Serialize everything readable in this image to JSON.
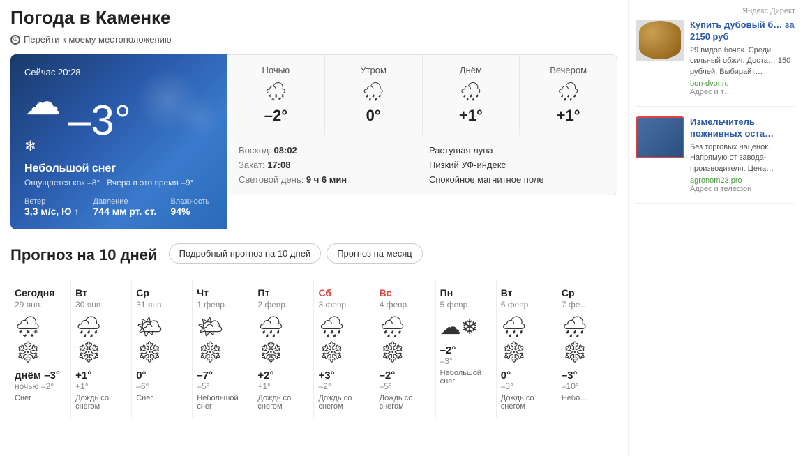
{
  "page": {
    "title": "Погода в Каменке",
    "location_link": "Перейти к моему местоположению"
  },
  "current": {
    "time": "Сейчас 20:28",
    "temp": "–3°",
    "icon": "🌨",
    "description": "Небольшой снег",
    "feels_like": "Ощущается как –8°",
    "yesterday": "Вчера в это время –9°",
    "wind_label": "Ветер",
    "wind_value": "3,3 м/с, Ю ↑",
    "pressure_label": "Давление",
    "pressure_value": "744 мм рт. ст.",
    "humidity_label": "Влажность",
    "humidity_value": "94%"
  },
  "periods": [
    {
      "name": "Ночью",
      "icon": "🌨",
      "temp": "–2°"
    },
    {
      "name": "Утром",
      "icon": "🌧",
      "temp": "0°"
    },
    {
      "name": "Днём",
      "icon": "🌧",
      "temp": "+1°"
    },
    {
      "name": "Вечером",
      "icon": "🌧",
      "temp": "+1°"
    }
  ],
  "sun_moon": [
    {
      "label": "Восход:",
      "value": "08:02"
    },
    {
      "label": "Растущая луна",
      "value": ""
    },
    {
      "label": "Закат:",
      "value": "17:08"
    },
    {
      "label": "Низкий УФ-индекс",
      "value": ""
    },
    {
      "label": "Световой день:",
      "value": "9 ч 6 мин"
    },
    {
      "label": "Спокойное магнитное поле",
      "value": ""
    }
  ],
  "forecast_section": {
    "title": "Прогноз на 10 дней",
    "btn1": "Подробный прогноз на 10 дней",
    "btn2": "Прогноз на месяц"
  },
  "ten_days": [
    {
      "name": "Сегодня",
      "date": "29 янв.",
      "icon": "🌨❄",
      "high": "днём –3°",
      "low": "ночью –2°",
      "desc": "Снег",
      "weekend": false
    },
    {
      "name": "Вт",
      "date": "30 янв.",
      "icon": "🌧❄",
      "high": "+1°",
      "low": "+1°",
      "desc": "Дождь со снегом",
      "weekend": false
    },
    {
      "name": "Ср",
      "date": "31 янв.",
      "icon": "🌤❄",
      "high": "0°",
      "low": "–6°",
      "desc": "Снег",
      "weekend": false
    },
    {
      "name": "Чт",
      "date": "1 февр.",
      "icon": "🌤❄",
      "high": "–7°",
      "low": "–5°",
      "desc": "Небольшой снег",
      "weekend": false
    },
    {
      "name": "Пт",
      "date": "2 февр.",
      "icon": "🌧❄",
      "high": "+2°",
      "low": "+1°",
      "desc": "Дождь со снегом",
      "weekend": false
    },
    {
      "name": "Сб",
      "date": "3 февр.",
      "icon": "🌧❄",
      "high": "+3°",
      "low": "–2°",
      "desc": "Дождь со снегом",
      "weekend": true
    },
    {
      "name": "Вс",
      "date": "4 февр.",
      "icon": "🌧❄",
      "high": "–2°",
      "low": "–5°",
      "desc": "Дождь со снегом",
      "weekend": true
    },
    {
      "name": "Пн",
      "date": "5 февр.",
      "icon": "☁❄",
      "high": "–2°",
      "low": "–3°",
      "desc": "Небольшой снег",
      "weekend": false
    },
    {
      "name": "Вт",
      "date": "6 февр.",
      "icon": "🌧❄",
      "high": "0°",
      "low": "–3°",
      "desc": "Дождь со снегом",
      "weekend": false
    },
    {
      "name": "Ср",
      "date": "7 фе…",
      "icon": "🌧❄",
      "high": "–3°",
      "low": "–10°",
      "desc": "Небо…",
      "weekend": false
    }
  ],
  "ads": {
    "label": "Яндекс.Директ",
    "items": [
      {
        "title": "Купить дубовый б… за 2150 руб",
        "text": "29 видов бочек. Среди сильный обжиг. Доста… 150 рублей. Выбирайт…",
        "site": "bon-dvor.ru",
        "link": "Адрес и т…",
        "type": "barrel"
      },
      {
        "title": "Измельчитель пожнивных оста…",
        "text": "Без торговых наценок. Напрямую от завода-производителя. Цена…",
        "site": "agronom23.pro",
        "link": "Адрес и телефон",
        "type": "machine"
      }
    ]
  }
}
